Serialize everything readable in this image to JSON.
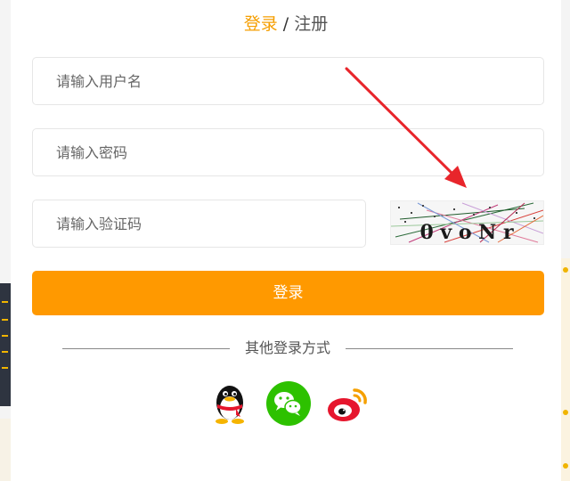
{
  "header": {
    "login_tab": "登录",
    "separator": "/",
    "register_tab": "注册"
  },
  "form": {
    "username_placeholder": "请输入用户名",
    "password_placeholder": "请输入密码",
    "captcha_placeholder": "请输入验证码",
    "captcha_text": "0 v o N r",
    "login_button": "登录"
  },
  "other_login": {
    "label": "其他登录方式",
    "providers": [
      {
        "name": "qq-icon"
      },
      {
        "name": "wechat-icon"
      },
      {
        "name": "weibo-icon"
      }
    ]
  },
  "colors": {
    "accent": "#ff9900",
    "login_tab": "#f59e00",
    "wechat": "#2dc100",
    "weibo": "#e6162d",
    "annotation_arrow": "#e8252b"
  }
}
